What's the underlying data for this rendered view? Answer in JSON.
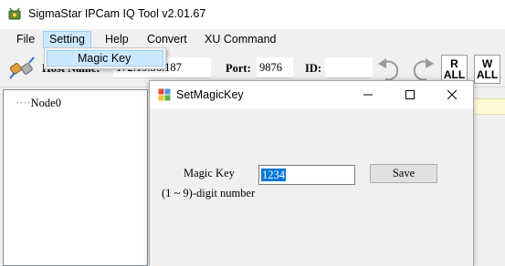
{
  "window": {
    "title": "SigmaStar IPCam IQ Tool v2.01.67"
  },
  "menu": {
    "items": [
      {
        "label": "File"
      },
      {
        "label": "Setting"
      },
      {
        "label": "Help"
      },
      {
        "label": "Convert"
      },
      {
        "label": "XU Command"
      }
    ],
    "setting_dropdown": {
      "items": [
        {
          "label": "Magic Key"
        }
      ]
    }
  },
  "toolbar": {
    "host_label": "Host Name:",
    "host_value": "172.19.36.187",
    "port_label": "Port:",
    "port_value": "9876",
    "id_label": "ID:",
    "id_value": "",
    "read_all": {
      "line1": "R",
      "line2": "ALL"
    },
    "write_all": {
      "line1": "W",
      "line2": "ALL"
    }
  },
  "tree": {
    "nodes": [
      {
        "label": "Node0"
      }
    ]
  },
  "dialog": {
    "title": "SetMagicKey",
    "field_label": "Magic Key",
    "field_hint": "(1 ~ 9)-digit number",
    "field_value": "1234",
    "save_label": "Save"
  },
  "colors": {
    "selection": "#0078d7",
    "menu_highlight": "#cce8ff",
    "menu_border": "#99d1ff"
  }
}
